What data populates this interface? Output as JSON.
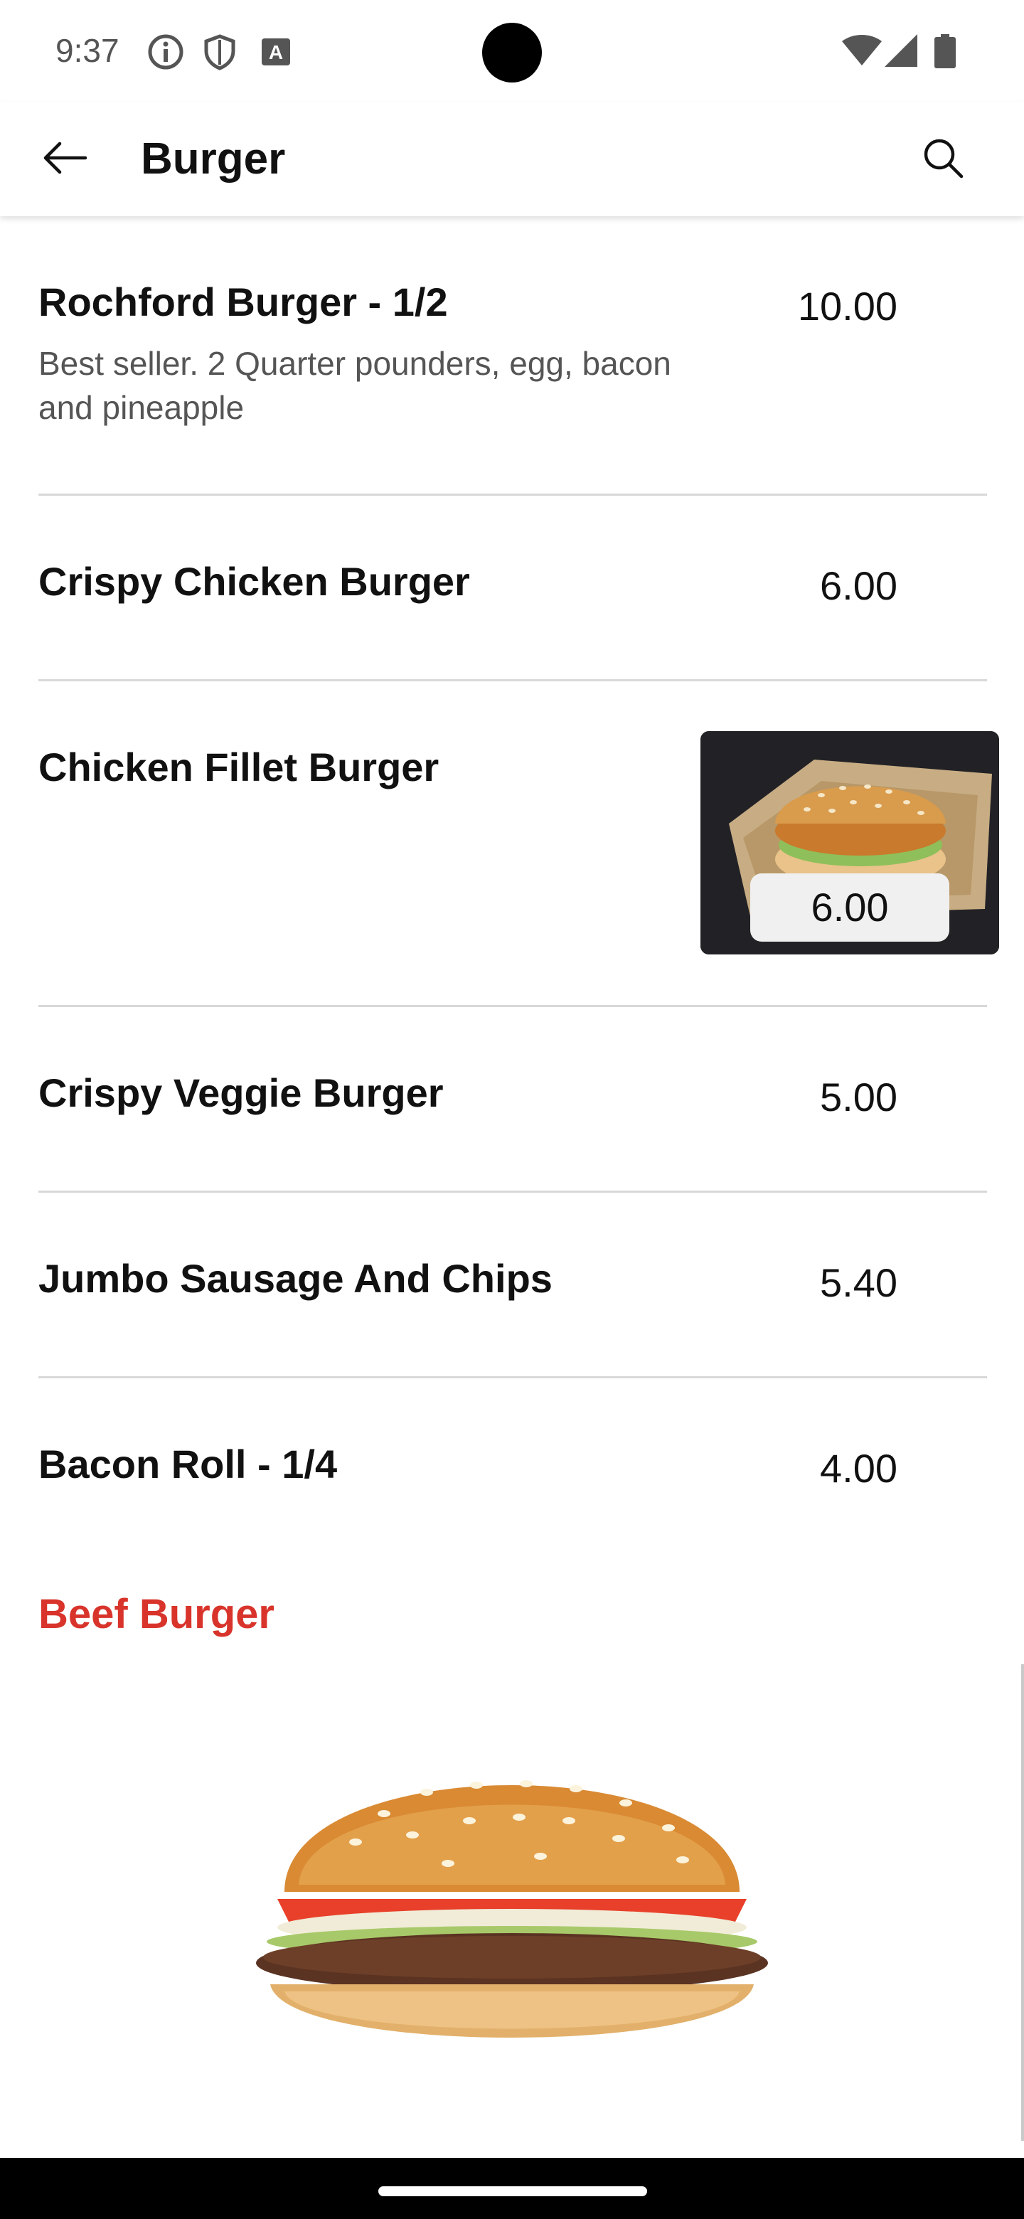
{
  "status_bar": {
    "time": "9:37",
    "icons": [
      "info-icon",
      "shield-icon",
      "text-a-icon"
    ],
    "right_icons": [
      "wifi-icon",
      "signal-icon",
      "battery-icon"
    ]
  },
  "app_bar": {
    "title": "Burger",
    "back_icon": "arrow-left-icon",
    "search_icon": "search-icon"
  },
  "menu_items": [
    {
      "name": "Rochford Burger - 1/2",
      "description": "Best seller. 2 Quarter pounders, egg, bacon and pineapple",
      "price": "10.00"
    },
    {
      "name": "Crispy Chicken Burger",
      "description": "",
      "price": "6.00"
    },
    {
      "name": "Chicken Fillet Burger",
      "description": "",
      "price": "6.00"
    },
    {
      "name": "Crispy Veggie Burger",
      "description": "",
      "price": "5.00"
    },
    {
      "name": "Jumbo Sausage And Chips",
      "description": "",
      "price": "5.40"
    },
    {
      "name": "Bacon Roll - 1/4",
      "description": "",
      "price": "4.00"
    }
  ],
  "section": {
    "title": "Beef Burger"
  },
  "colors": {
    "accent": "#d8342b",
    "divider": "#d8d8d8",
    "text": "#111111",
    "muted": "#555555"
  }
}
